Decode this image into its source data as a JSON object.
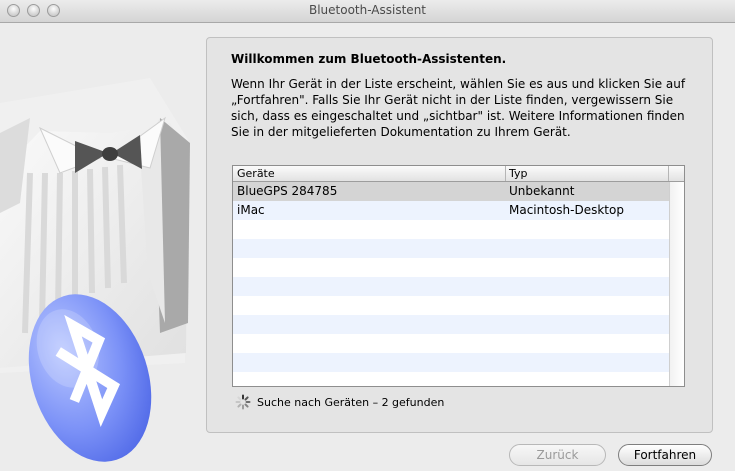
{
  "window": {
    "title": "Bluetooth-Assistent"
  },
  "content": {
    "heading": "Willkommen zum Bluetooth-Assistenten.",
    "description": "Wenn Ihr Gerät in der Liste erscheint, wählen Sie es aus und klicken Sie auf „Fortfahren\". Falls Sie Ihr Gerät nicht in der Liste finden, vergewissern Sie sich, dass es eingeschaltet und „sichtbar\" ist. Weitere Informationen finden Sie in der mitgelieferten Dokumentation zu Ihrem Gerät."
  },
  "devices": {
    "columns": [
      "Geräte",
      "Typ"
    ],
    "rows": [
      {
        "name": "BlueGPS 284785",
        "type": "Unbekannt",
        "selected": true
      },
      {
        "name": "iMac",
        "type": "Macintosh-Desktop",
        "selected": false
      }
    ]
  },
  "status": {
    "text": "Suche nach Geräten – 2 gefunden"
  },
  "buttons": {
    "back": "Zurück",
    "continue": "Fortfahren"
  },
  "icons": {
    "spinner": "progress-spinner-icon",
    "artwork": "bluetooth-tuxedo-artwork"
  },
  "colors": {
    "selected_row": "#d4d4d4",
    "alternate_row": "#edf3fe",
    "bluetooth_blue": "#6f86f3"
  }
}
